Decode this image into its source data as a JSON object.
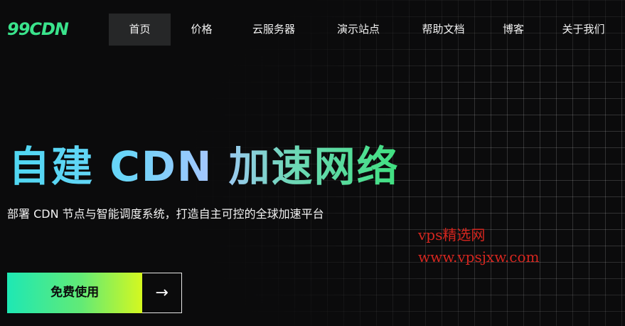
{
  "header": {
    "logo_text": "99CDN",
    "nav": [
      {
        "label": "首页",
        "active": true
      },
      {
        "label": "价格"
      },
      {
        "label": "云服务器"
      },
      {
        "label": "演示站点"
      },
      {
        "label": "帮助文档"
      },
      {
        "label": "博客"
      },
      {
        "label": "关于我们"
      }
    ]
  },
  "hero": {
    "title": "自建 CDN 加速网络",
    "subtitle": "部署 CDN 节点与智能调度系统，打造自主可控的全球加速平台",
    "cta_label": "免费使用",
    "cta_icon": "arrow-right-icon"
  },
  "watermark": {
    "line1": "vps精选网",
    "line2": "www.vpsjxw.com"
  },
  "colors": {
    "background": "#0b0b0c",
    "nav_active_bg": "#262728",
    "logo": "#3ae38c",
    "cta_gradient_start": "#1ee8b4",
    "cta_gradient_end": "#d5f81f",
    "watermark": "#d4261f"
  }
}
